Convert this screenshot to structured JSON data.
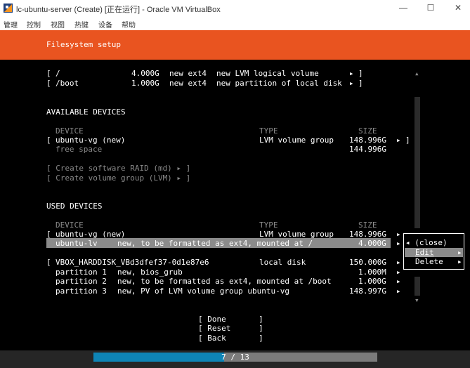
{
  "window": {
    "title": "lc-ubuntu-server (Create) [正在运行] - Oracle VM VirtualBox",
    "minimize": "—",
    "maximize": "☐",
    "close": "✕"
  },
  "menu": [
    "管理",
    "控制",
    "视图",
    "热键",
    "设备",
    "帮助"
  ],
  "header": {
    "title": "Filesystem setup"
  },
  "mounts": [
    {
      "open": "[",
      "path": "/",
      "size": "4.000G",
      "fmt": "new ext4",
      "desc": "new LVM logical volume",
      "arrow": "▸",
      "close": "]"
    },
    {
      "open": "[",
      "path": "/boot",
      "size": "1.000G",
      "fmt": "new ext4",
      "desc": "new partition of local disk",
      "arrow": "▸",
      "close": "]"
    }
  ],
  "available": {
    "heading": "AVAILABLE DEVICES",
    "col_device": "DEVICE",
    "col_type": "TYPE",
    "col_size": "SIZE",
    "device_open": "[",
    "device_name": "ubuntu-vg (new)",
    "device_type": "LVM volume group",
    "device_size": "148.996G",
    "device_arrow": "▸",
    "device_close": "]",
    "free_label": "free space",
    "free_size": "144.996G",
    "create_raid": "[ Create software RAID (md) ▸ ]",
    "create_vg": "[ Create volume group (LVM) ▸ ]"
  },
  "used": {
    "heading": "USED DEVICES",
    "col_device": "DEVICE",
    "col_type": "TYPE",
    "col_size": "SIZE",
    "vg_open": "[",
    "vg_name": "ubuntu-vg (new)",
    "vg_type": "LVM volume group",
    "vg_size": "148.996G",
    "vg_arrow": "▸",
    "lv_name": "ubuntu-lv",
    "lv_desc": "new, to be formatted as ext4, mounted at /",
    "lv_size": "4.000G",
    "lv_arrow": "▸",
    "disk_open": "[",
    "disk_name": "VBOX_HARDDISK_VBd3dfef37-0d1e87e6",
    "disk_type": "local disk",
    "disk_size": "150.000G",
    "disk_arrow": "▸",
    "partitions": [
      {
        "name": "partition 1",
        "desc": "new, bios_grub",
        "size": "1.000M",
        "arrow": "▸"
      },
      {
        "name": "partition 2",
        "desc": "new, to be formatted as ext4, mounted at /boot",
        "size": "1.000G",
        "arrow": "▸"
      },
      {
        "name": "partition 3",
        "desc": "new, PV of LVM volume group ubuntu-vg",
        "size": "148.997G",
        "arrow": "▸"
      }
    ]
  },
  "popup": {
    "items": [
      {
        "label": "◂ (close)",
        "arrow": ""
      },
      {
        "label": "Edit",
        "arrow": "▸"
      },
      {
        "label": "Delete",
        "arrow": "▸"
      }
    ]
  },
  "scroll_up": "▴",
  "scroll_down": "▾",
  "buttons": {
    "done": "[ Done       ]",
    "reset": "[ Reset      ]",
    "back": "[ Back       ]"
  },
  "progress": {
    "text": "7 / 13",
    "fraction": 0.4615
  },
  "colors": {
    "header": "#e95420",
    "progress_fill": "#0e84b5",
    "highlight": "#8b8b8b"
  }
}
